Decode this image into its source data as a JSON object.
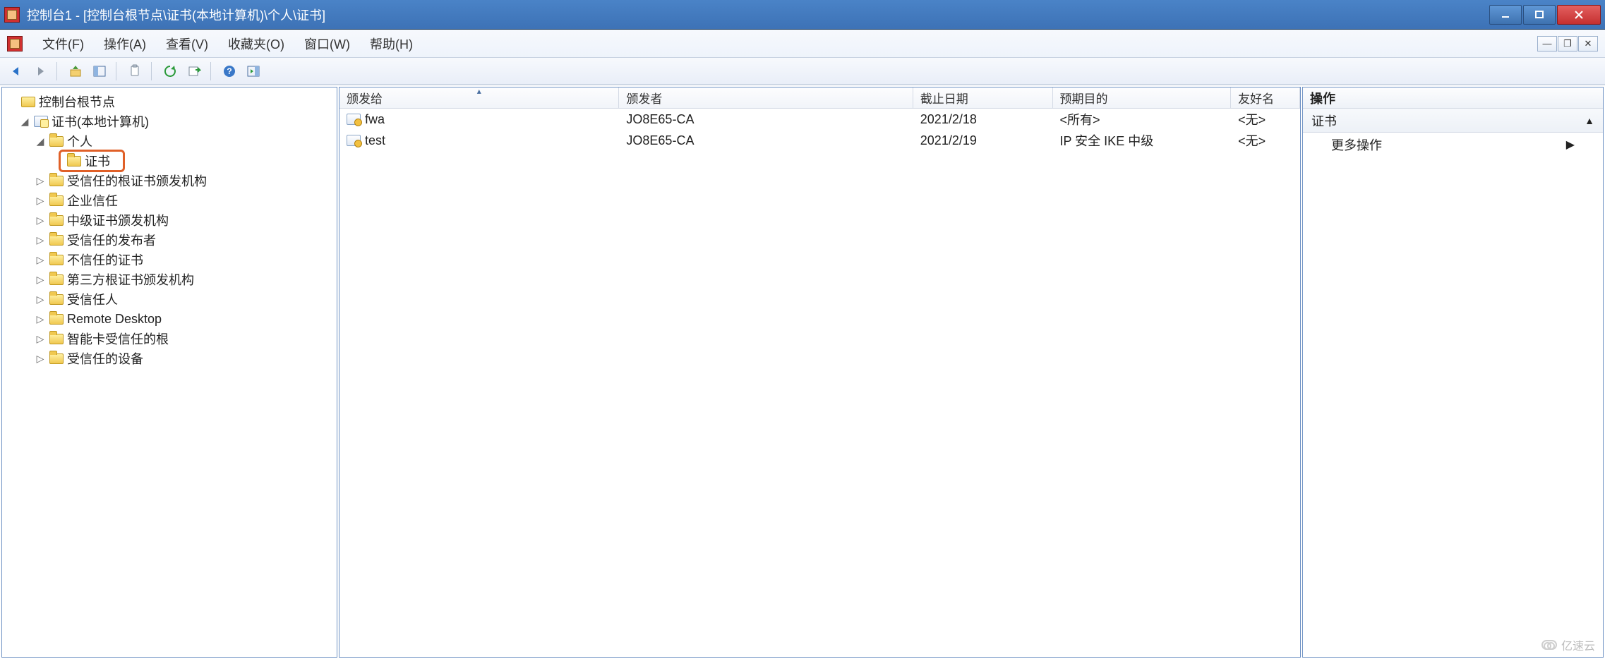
{
  "window": {
    "title": "控制台1 - [控制台根节点\\证书(本地计算机)\\个人\\证书]"
  },
  "menu": {
    "file": "文件(F)",
    "action": "操作(A)",
    "view": "查看(V)",
    "favorites": "收藏夹(O)",
    "window": "窗口(W)",
    "help": "帮助(H)"
  },
  "tree": {
    "root": "控制台根节点",
    "cert_local": "证书(本地计算机)",
    "personal": "个人",
    "certs": "证书",
    "items": [
      "受信任的根证书颁发机构",
      "企业信任",
      "中级证书颁发机构",
      "受信任的发布者",
      "不信任的证书",
      "第三方根证书颁发机构",
      "受信任人",
      "Remote Desktop",
      "智能卡受信任的根",
      "受信任的设备"
    ]
  },
  "columns": {
    "issued_to": "颁发给",
    "issued_by": "颁发者",
    "expiry": "截止日期",
    "purpose": "预期目的",
    "friendly": "友好名"
  },
  "rows": [
    {
      "issued_to": "fwa",
      "issued_by": "JO8E65-CA",
      "expiry": "2021/2/18",
      "purpose": "<所有>",
      "friendly": "<无>"
    },
    {
      "issued_to": "test",
      "issued_by": "JO8E65-CA",
      "expiry": "2021/2/19",
      "purpose": "IP 安全 IKE 中级",
      "friendly": "<无>"
    }
  ],
  "actions": {
    "header": "操作",
    "section": "证书",
    "more": "更多操作"
  },
  "watermark": "亿速云"
}
